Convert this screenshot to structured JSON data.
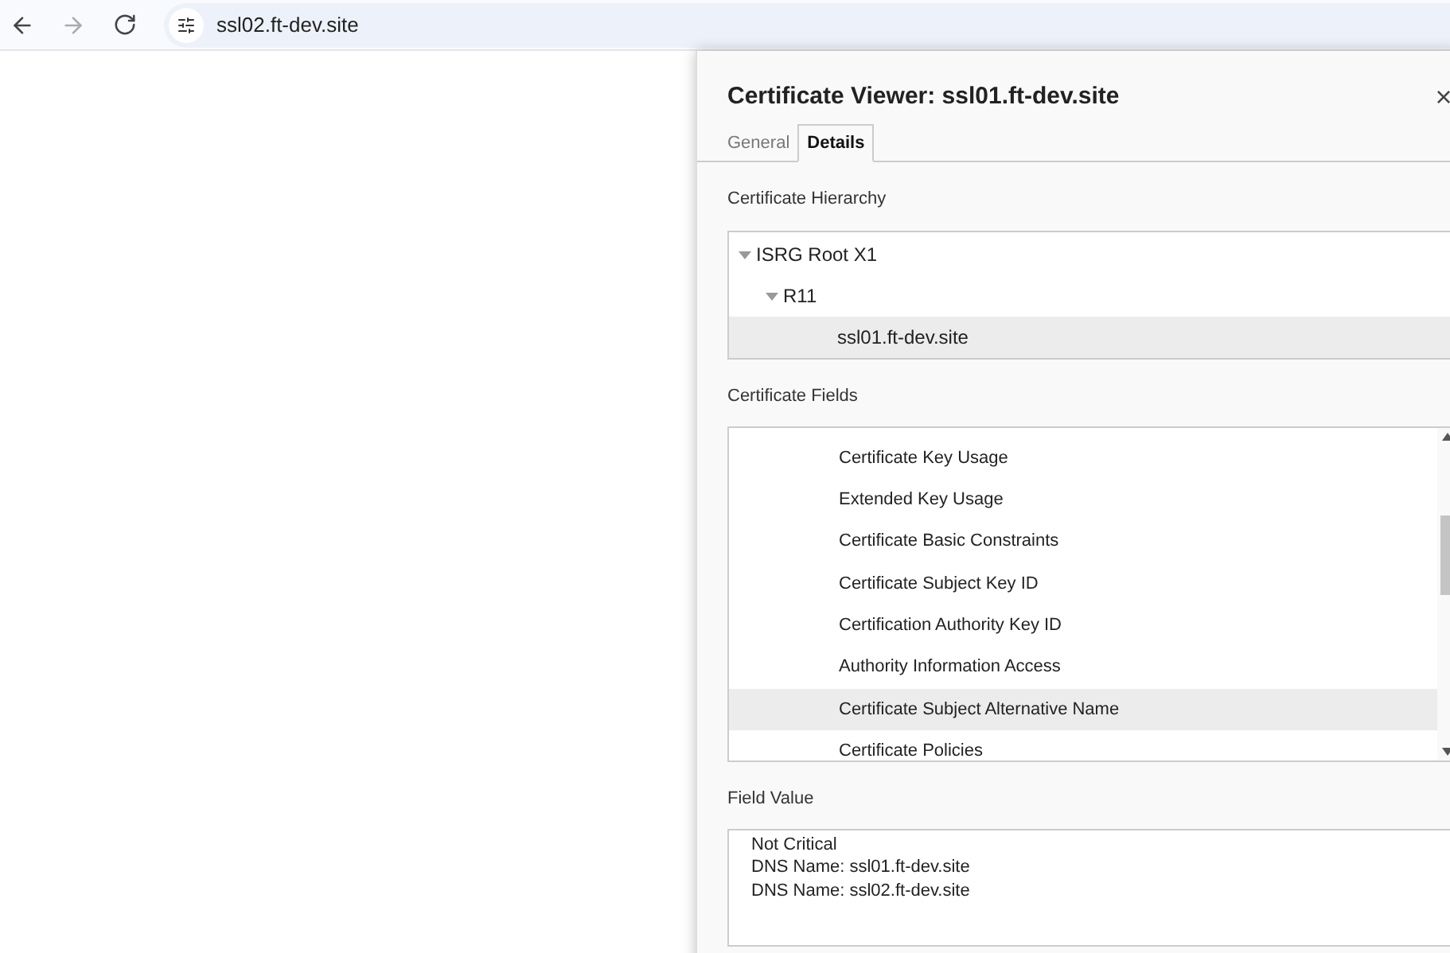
{
  "browser": {
    "address": "ssl02.ft-dev.site"
  },
  "dialog": {
    "title": "Certificate Viewer: ssl01.ft-dev.site",
    "close": "×",
    "tabs": [
      {
        "label": "General",
        "selected": false
      },
      {
        "label": "Details",
        "selected": true
      }
    ],
    "hierarchy_label": "Certificate Hierarchy",
    "hierarchy": [
      {
        "label": "ISRG Root X1",
        "expanded": true,
        "selected": false,
        "children": [
          {
            "label": "R11",
            "expanded": true,
            "selected": false,
            "children": [
              {
                "label": "ssl01.ft-dev.site",
                "selected": true
              }
            ]
          }
        ]
      }
    ],
    "fields_label": "Certificate Fields",
    "fields": [
      {
        "label": "Certificate Key Usage",
        "selected": false
      },
      {
        "label": "Extended Key Usage",
        "selected": false
      },
      {
        "label": "Certificate Basic Constraints",
        "selected": false
      },
      {
        "label": "Certificate Subject Key ID",
        "selected": false
      },
      {
        "label": "Certification Authority Key ID",
        "selected": false
      },
      {
        "label": "Authority Information Access",
        "selected": false
      },
      {
        "label": "Certificate Subject Alternative Name",
        "selected": true
      },
      {
        "label": "Certificate Policies",
        "selected": false
      }
    ],
    "value_label": "Field Value",
    "value_lines": [
      "Not Critical",
      "DNS Name: ssl01.ft-dev.site",
      "DNS Name: ssl02.ft-dev.site"
    ]
  }
}
